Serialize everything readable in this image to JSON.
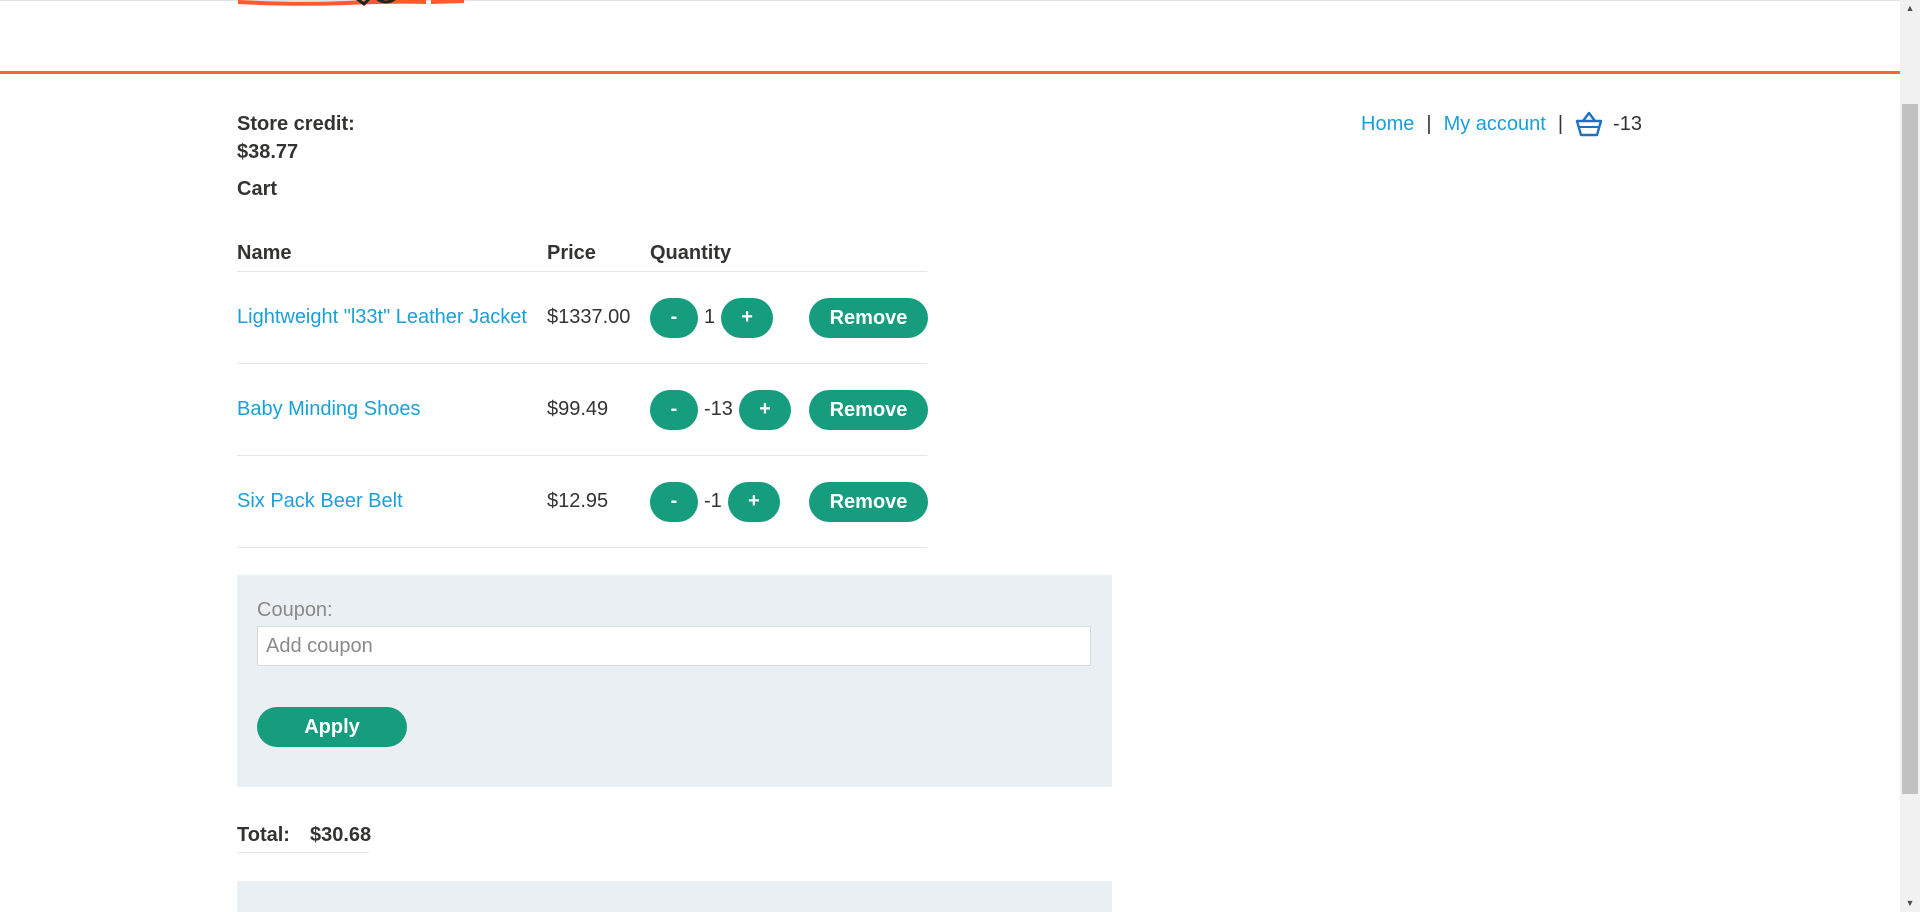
{
  "nav": {
    "home": "Home",
    "separator": "|",
    "my_account": "My account",
    "cart_count": "-13"
  },
  "store_credit": {
    "label": "Store credit:",
    "amount": "$38.77"
  },
  "cart": {
    "heading": "Cart",
    "columns": {
      "name": "Name",
      "price": "Price",
      "quantity": "Quantity"
    },
    "items": [
      {
        "name": "Lightweight \"l33t\" Leather Jacket",
        "price": "$1337.00",
        "quantity": "1"
      },
      {
        "name": "Baby Minding Shoes",
        "price": "$99.49",
        "quantity": "-13"
      },
      {
        "name": "Six Pack Beer Belt",
        "price": "$12.95",
        "quantity": "-1"
      }
    ],
    "minus_label": "-",
    "plus_label": "+",
    "remove_label": "Remove"
  },
  "coupon": {
    "label": "Coupon:",
    "placeholder": "Add coupon",
    "apply_label": "Apply"
  },
  "total": {
    "label": "Total:",
    "amount": "$30.68"
  },
  "colors": {
    "accent": "#ff6633",
    "link": "#1aa0d8",
    "button": "#159d7e",
    "panel": "#e9eff2"
  }
}
